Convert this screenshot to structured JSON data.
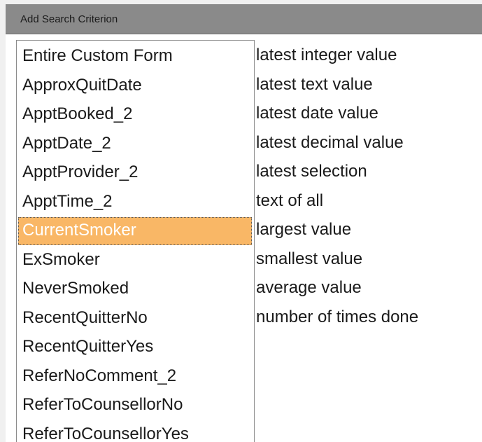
{
  "dialog": {
    "title": "Add Search Criterion"
  },
  "fields": {
    "selected_index": 6,
    "items": [
      "Entire Custom Form",
      "ApproxQuitDate",
      "ApptBooked_2",
      "ApptDate_2",
      "ApptProvider_2",
      "ApptTime_2",
      "CurrentSmoker",
      "ExSmoker",
      "NeverSmoked",
      "RecentQuitterNo",
      "RecentQuitterYes",
      "ReferNoComment_2",
      "ReferToCounsellorNo",
      "ReferToCounsellorYes"
    ]
  },
  "functions": {
    "items": [
      "latest integer value",
      "latest text value",
      "latest date value",
      "latest decimal value",
      "latest selection",
      "text of all",
      "largest value",
      "smallest value",
      "average value",
      "number of times done"
    ]
  },
  "colors": {
    "titlebar": "#8a8a8a",
    "selection": "#f9b766",
    "selection_text": "#ffffff"
  }
}
